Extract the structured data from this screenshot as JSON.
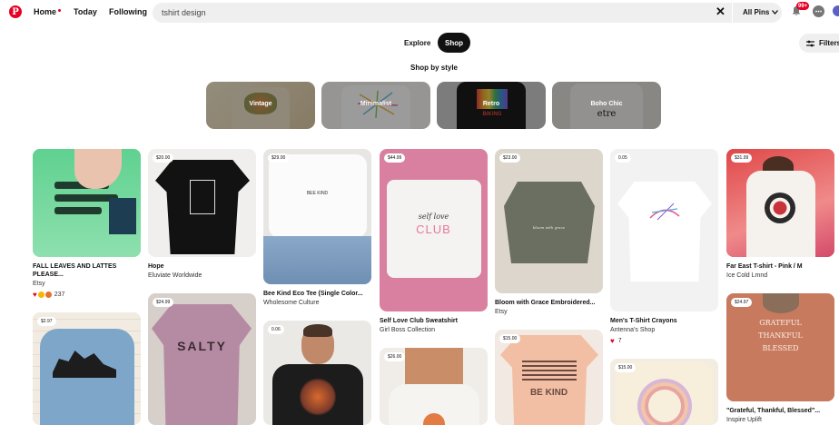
{
  "header": {
    "logo": "P",
    "nav": {
      "home": "Home",
      "today": "Today",
      "following": "Following"
    },
    "search": {
      "value": "tshirt design",
      "placeholder": "Search"
    },
    "all_pins": "All Pins",
    "notifications_badge": "99+"
  },
  "toggle": {
    "explore": "Explore",
    "shop": "Shop"
  },
  "filters_label": "Filters",
  "style_section": {
    "title": "Shop by style",
    "styles": [
      "Vintage",
      "Minimalist",
      "Retro",
      "Boho Chic"
    ]
  },
  "pins": [
    {
      "title": "FALL LEAVES AND LATTES PLEASE...",
      "source": "Etsy",
      "reactions": "237"
    },
    {
      "price": "$20.00",
      "title": "Hope",
      "source": "Eluviate Worldwide"
    },
    {
      "price": "$29.00",
      "title": "Bee Kind Eco Tee (Single Color...",
      "source": "Wholesome Culture"
    },
    {
      "price": "$44.99",
      "title": "Self Love Club Sweatshirt",
      "source": "Girl Boss Collection"
    },
    {
      "price": "$23.00",
      "title": "Bloom with Grace Embroidered...",
      "source": "Etsy"
    },
    {
      "price": "0.05",
      "title": "Men's T-Shirt Crayons",
      "source": "Antenna's Shop",
      "reactions": "7"
    },
    {
      "price": "$31.99",
      "title": "Far East T-shirt - Pink / M",
      "source": "Ice Cold Lmnd"
    },
    {
      "price": "$2.97"
    },
    {
      "price": "$24.99"
    },
    {
      "price": "0.06"
    },
    {
      "price": "$26.00"
    },
    {
      "price": "$15.00"
    },
    {
      "price": "$15.00"
    },
    {
      "price": "$24.97",
      "title": "\"Grateful, Thankful, Blessed\"...",
      "source": "Inspire Uplift"
    }
  ],
  "image_texts": {
    "bee_kind": "BEE KIND",
    "self_love_top": "self love",
    "self_love_club": "CLUB",
    "bloom_text": "bloom with grace",
    "salty": "SALTY",
    "be_kind": "BE KIND",
    "grateful": "GRATEFUL",
    "thankful": "THANKFUL",
    "blessed": "BLESSED",
    "boho": "etre",
    "retro_shirt": "BIKING"
  },
  "colors": {
    "brand": "#e60023"
  }
}
